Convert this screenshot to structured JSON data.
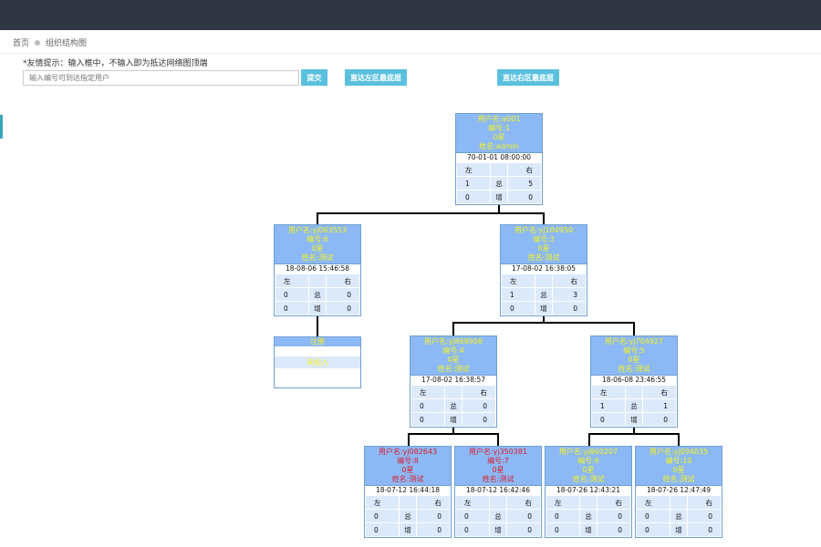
{
  "breadcrumb": {
    "home": "首页",
    "current": "组织结构图"
  },
  "tip": "*友情提示：输入框中，不输入即为抵达网络图顶端",
  "search": {
    "placeholder": "输入编号可到达指定用户",
    "submit_label": "提交"
  },
  "buttons": {
    "left_bottom": "直达左区最底层",
    "right_bottom": "直达右区最底层"
  },
  "table_labels": {
    "left": "左",
    "right": "右",
    "total": "总",
    "add": "增"
  },
  "register": {
    "title": "注册",
    "join": "未加入"
  },
  "nodes": {
    "root": {
      "username": "用户名:a001",
      "number": "编号:1",
      "star": "0星",
      "name": "姓名:admin",
      "time": "70-01-01 08:00:00",
      "total_left": "1",
      "total_right": "5",
      "add_left": "0",
      "add_right": "0"
    },
    "n2": {
      "username": "用户名:yj063553",
      "number": "编号:6",
      "star": "0星",
      "name": "姓名:测试",
      "time": "18-08-06 15:46:58",
      "total_left": "0",
      "total_right": "0",
      "add_left": "0",
      "add_right": "0"
    },
    "n3": {
      "username": "用户名:yj104950",
      "number": "编号:3",
      "star": "0星",
      "name": "姓名:测试",
      "time": "17-08-02 16:38:05",
      "total_left": "1",
      "total_right": "3",
      "add_left": "0",
      "add_right": "0"
    },
    "n4": {
      "username": "用户名:yj868908",
      "number": "编号:4",
      "star": "0星",
      "name": "姓名:测试",
      "time": "17-08-02 16:38:57",
      "total_left": "0",
      "total_right": "0",
      "add_left": "0",
      "add_right": "0"
    },
    "n5": {
      "username": "用户名:yj704927",
      "number": "编号:5",
      "star": "0星",
      "name": "姓名:测试",
      "time": "18-06-08 23:46:55",
      "total_left": "1",
      "total_right": "1",
      "add_left": "0",
      "add_right": "0"
    },
    "n6": {
      "username": "用户名:yj082643",
      "number": "编号:8",
      "star": "0星",
      "name": "姓名:测试",
      "time": "18-07-12 16:44:18",
      "total_left": "0",
      "total_right": "0",
      "add_left": "0",
      "add_right": "0"
    },
    "n7": {
      "username": "用户名:yj350381",
      "number": "编号:7",
      "star": "0星",
      "name": "姓名:测试",
      "time": "18-07-12 16:42:46",
      "total_left": "0",
      "total_right": "0",
      "add_left": "0",
      "add_right": "0"
    },
    "n8": {
      "username": "用户名:yj860207",
      "number": "编号:9",
      "star": "0星",
      "name": "姓名:测试",
      "time": "18-07-26 12:43:21",
      "total_left": "0",
      "total_right": "0",
      "add_left": "0",
      "add_right": "0"
    },
    "n9": {
      "username": "用户名:yj094035",
      "number": "编号:10",
      "star": "0星",
      "name": "姓名:测试",
      "time": "18-07-26 12:47:49",
      "total_left": "0",
      "total_right": "0",
      "add_left": "0",
      "add_right": "0"
    }
  }
}
